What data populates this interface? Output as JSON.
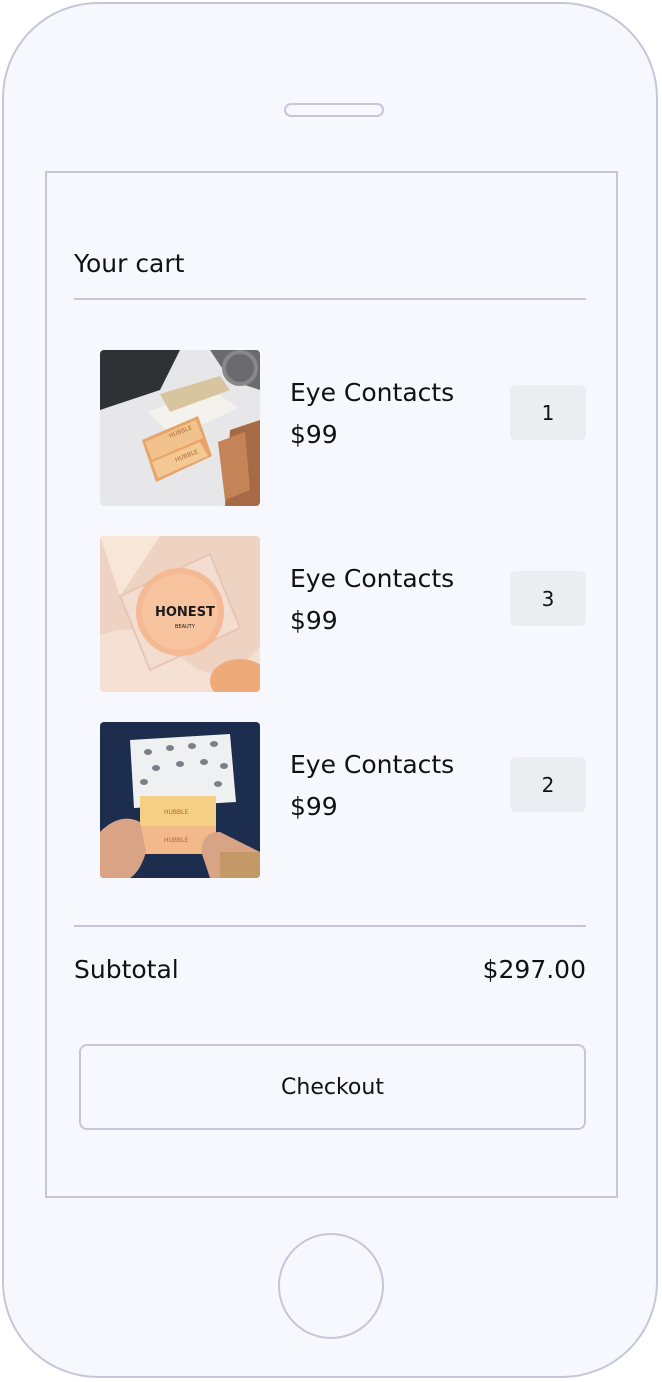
{
  "cart": {
    "title": "Your cart",
    "items": [
      {
        "name": "Eye Contacts",
        "price": "$99",
        "quantity": "1",
        "image": "hubble-contacts-box-image"
      },
      {
        "name": "Eye Contacts",
        "price": "$99",
        "quantity": "3",
        "image": "honest-beauty-compact-image"
      },
      {
        "name": "Eye Contacts",
        "price": "$99",
        "quantity": "2",
        "image": "hubble-box-in-hands-image"
      }
    ],
    "subtotal_label": "Subtotal",
    "subtotal_value": "$297.00",
    "checkout_label": "Checkout"
  },
  "images": {
    "honest_brand": "HONEST",
    "honest_sub": "BEAUTY",
    "hubble_brand": "HUBBLE"
  },
  "colors": {
    "device_outline": "#c4c7da",
    "screen_background": "#f7f8fd",
    "quantity_background": "#ecedf1"
  }
}
